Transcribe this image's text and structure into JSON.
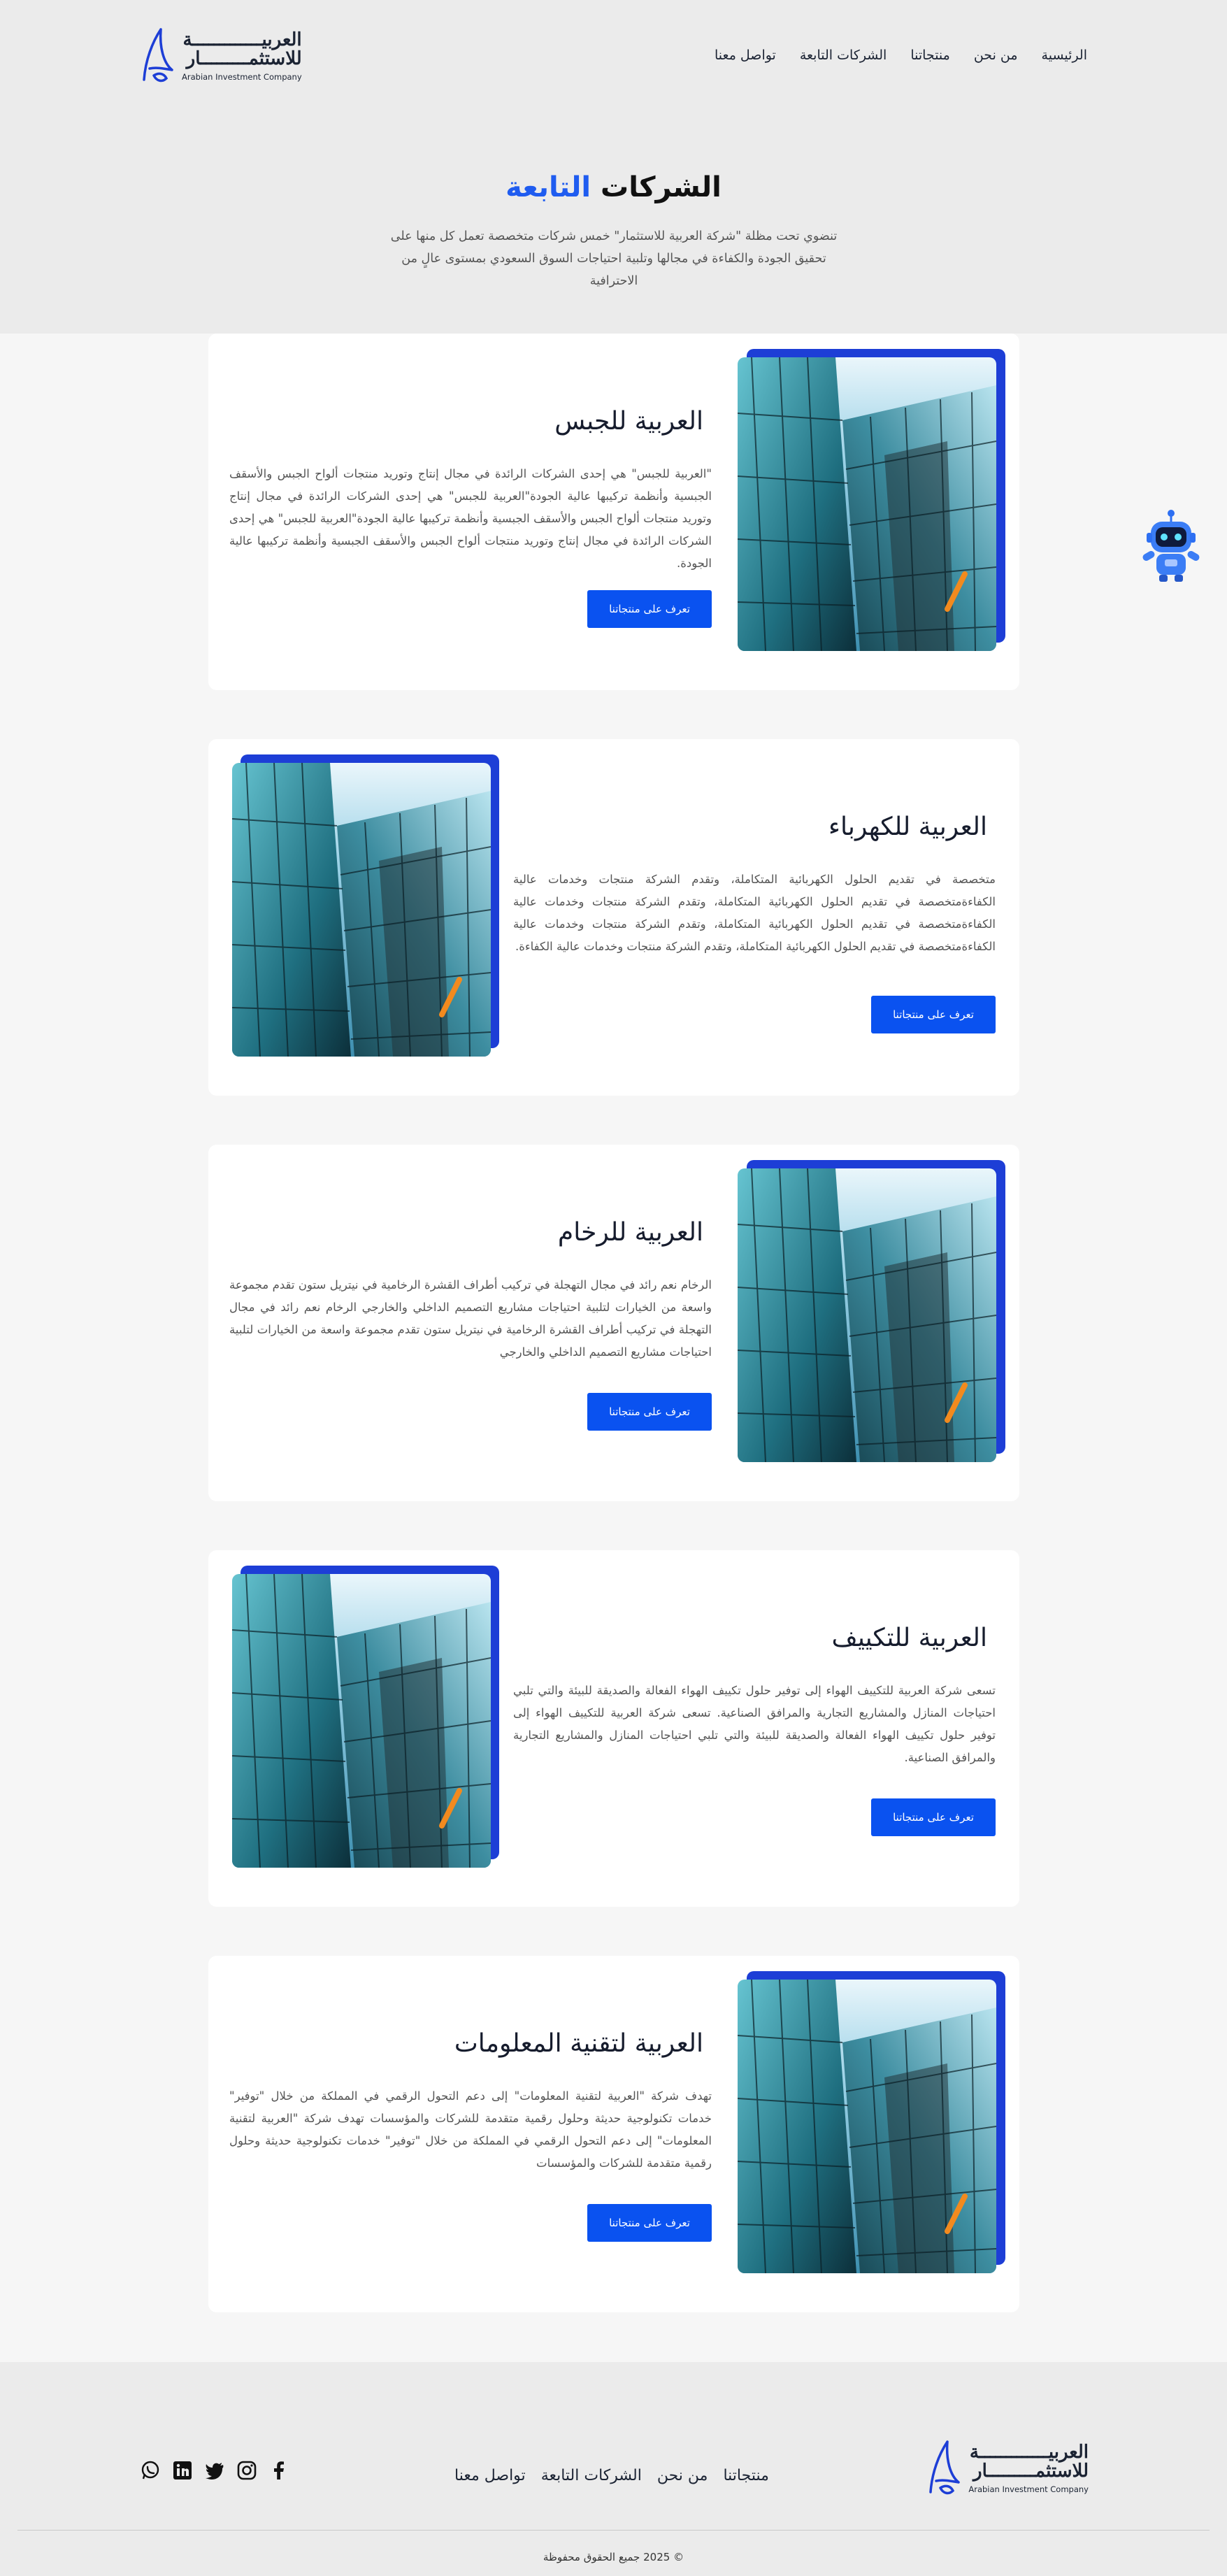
{
  "colors": {
    "accent": "#1f5cf0",
    "button": "#0a52f0",
    "backing": "#1d3ed6"
  },
  "brand": {
    "name_line1": "العربيـــــــــــــة",
    "name_line2": "للاستثمـــــــــار",
    "name_en": "Arabian Investment Company",
    "icon": "logo-icon"
  },
  "nav": {
    "items": [
      "الرئيسية",
      "من نحن",
      "منتجاتنا",
      "الشركات التابعة",
      "تواصل معنا"
    ]
  },
  "hero": {
    "title_main": "الشركات",
    "title_accent": "التابعة",
    "lead": "تنضوي تحت مظلة \"شركة العربية للاستثمار\" خمس شركات متخصصة تعمل كل منها على تحقيق الجودة والكفاءة في مجالها وتلبية احتياجات السوق السعودي بمستوى عالٍ من الاحترافية"
  },
  "companies": [
    {
      "title": "العربية للجبس",
      "body": "\"العربية للجبس\" هي إحدى الشركات الرائدة في مجال إنتاج وتوريد منتجات ألواح الجبس والأسقف الجبسية وأنظمة تركيبها عالية الجودة\"العربية للجبس\" هي إحدى الشركات الرائدة في مجال إنتاج وتوريد منتجات ألواح الجبس والأسقف الجبسية وأنظمة تركيبها عالية الجودة\"العربية للجبس\" هي إحدى الشركات الرائدة في مجال إنتاج وتوريد منتجات ألواح الجبس والأسقف الجبسية وأنظمة تركيبها عالية الجودة.",
      "button": "تعرف على منتجاتنا"
    },
    {
      "title": "العربية للكهرباء",
      "body": "متخصصة في تقديم الحلول الكهربائية المتكاملة، وتقدم الشركة منتجات وخدمات عالية الكفاءةمتخصصة في تقديم الحلول الكهربائية المتكاملة، وتقدم الشركة منتجات وخدمات عالية الكفاءةمتخصصة في تقديم الحلول الكهربائية المتكاملة، وتقدم الشركة منتجات وخدمات عالية الكفاءةمتخصصة في تقديم الحلول الكهربائية المتكاملة، وتقدم الشركة منتجات وخدمات عالية الكفاءة.",
      "button": "تعرف على منتجاتنا"
    },
    {
      "title": "العربية للرخام",
      "body": "الرخام نعم رائد في مجال التهجلة في تركيب أطراف القشرة الرخامية في نيتريل ستون تقدم مجموعة واسعة من الخيارات لتلبية احتياجات مشاريع التصميم الداخلي والخارجي الرخام نعم رائد في مجال التهجلة في تركيب أطراف القشرة الرخامية في نيتريل ستون تقدم مجموعة واسعة من الخيارات لتلبية احتياجات مشاريع التصميم الداخلي والخارجي",
      "button": "تعرف على منتجاتنا"
    },
    {
      "title": "العربية للتكييف",
      "body": "تسعى شركة العربية للتكييف الهواء إلى توفير حلول تكييف الهواء الفعالة والصديقة للبيئة والتي تلبي احتياجات المنازل والمشاريع التجارية والمرافق الصناعية. تسعى شركة العربية للتكييف الهواء إلى توفير حلول تكييف الهواء الفعالة والصديقة للبيئة والتي تلبي احتياجات المنازل والمشاريع التجارية والمرافق الصناعية.",
      "button": "تعرف على منتجاتنا"
    },
    {
      "title": "العربية لتقنية المعلومات",
      "body": "تهدف شركة \"العربية لتقنية المعلومات\" إلى دعم التحول الرقمي في المملكة من خلال \"توفير\" خدمات تكنولوجية حديثة وحلول رقمية متقدمة للشركات والمؤسسات تهدف شركة \"العربية لتقنية المعلومات\" إلى دعم التحول الرقمي في المملكة من خلال \"توفير\" خدمات تكنولوجية حديثة وحلول رقمية متقدمة للشركات والمؤسسات",
      "button": "تعرف على منتجاتنا"
    }
  ],
  "chatbot": {
    "icon": "robot-icon"
  },
  "footer": {
    "nav": [
      "منتجاتنا",
      "من نحن",
      "الشركات التابعة",
      "تواصل معنا"
    ],
    "social": [
      "facebook-icon",
      "instagram-icon",
      "twitter-icon",
      "linkedin-icon",
      "whatsapp-icon"
    ],
    "copyright": "© 2025 جميع الحقوق محفوظة"
  }
}
